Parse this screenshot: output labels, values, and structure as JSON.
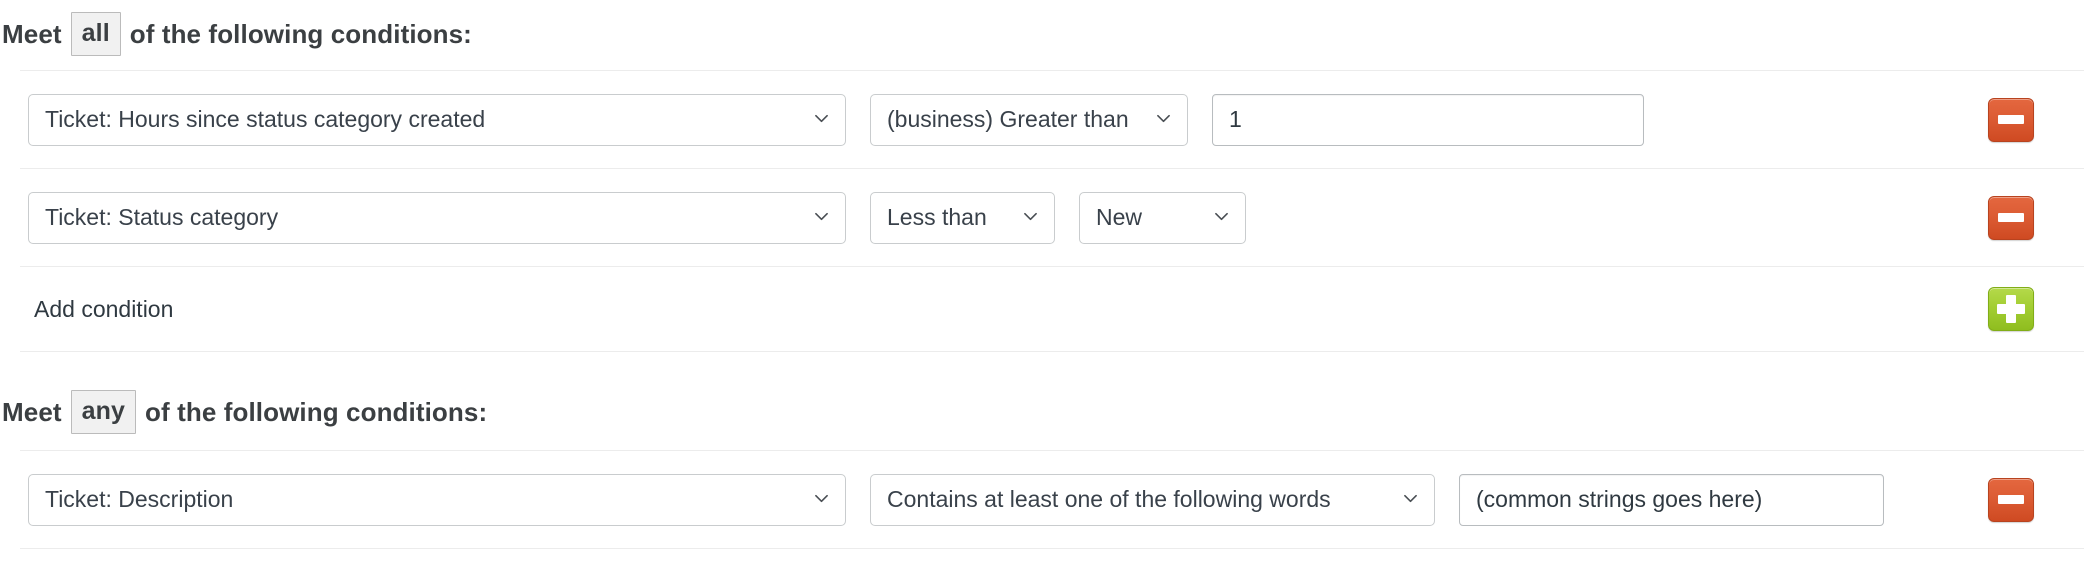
{
  "sections": [
    {
      "heading": {
        "lead": "Meet",
        "keyword": "all",
        "tail": "of the following conditions:"
      },
      "rows": [
        {
          "field": "Ticket: Hours since status category created",
          "operator": "(business) Greater than",
          "value": "1",
          "value_type": "text",
          "remove_label": "Remove condition"
        },
        {
          "field": "Ticket: Status category",
          "operator": "Less than",
          "value": "New",
          "value_type": "select",
          "remove_label": "Remove condition"
        }
      ],
      "add": {
        "label": "Add condition",
        "button_label": "Add condition"
      }
    },
    {
      "heading": {
        "lead": "Meet",
        "keyword": "any",
        "tail": "of the following conditions:"
      },
      "rows": [
        {
          "field": "Ticket: Description",
          "operator": "Contains at least one of the following words",
          "value": "(common strings goes here)",
          "value_type": "text",
          "remove_label": "Remove condition"
        }
      ]
    }
  ],
  "icons": {
    "chevron": "chevron-down-icon",
    "minus": "minus-icon",
    "plus": "plus-icon"
  },
  "colors": {
    "remove_button": "#d9542b",
    "add_button": "#a3ce33",
    "text": "#2f3941",
    "border": "#c9ccce",
    "separator": "#ececec",
    "keyword_bg": "#f1f1f1"
  }
}
